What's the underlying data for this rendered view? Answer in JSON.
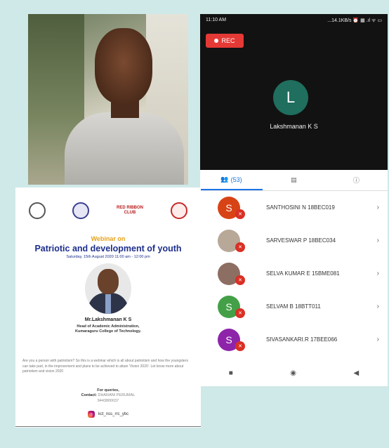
{
  "phone": {
    "time": "11:10 AM",
    "network": "...14.1KB/s ⏰ ▦ .ıl ᯤ ▭",
    "rec_label": "REC",
    "host_initial": "L",
    "host_name": "Lakshmanan K S",
    "tabs": [
      {
        "label": "(53)",
        "icon": "people-icon"
      },
      {
        "label": "",
        "icon": "chat-icon"
      },
      {
        "label": "",
        "icon": "info-icon"
      }
    ],
    "participants": [
      {
        "initial": "S",
        "name": "SANTHOSINI N 18BEC019",
        "color": "#d84315"
      },
      {
        "initial": "",
        "name": "SARVESWAR P 18BEC034",
        "color": "#9e8a7a"
      },
      {
        "initial": "",
        "name": "SELVA KUMAR E 15BME081",
        "color": "#8d6e63"
      },
      {
        "initial": "S",
        "name": "SELVAM B 18BTT011",
        "color": "#43a047"
      },
      {
        "initial": "S",
        "name": "SIVASANKARI.R 17BEE066",
        "color": "#8e24aa"
      }
    ],
    "nav": [
      "■",
      "◉",
      "◀"
    ]
  },
  "poster": {
    "logo_text": "RED RIBBON CLUB",
    "webinar_on": "Webinar on",
    "title": "Patriotic and development of youth",
    "date": "Saturday, 15th August 2020  11:00 am - 12:00 pm",
    "speaker_name": "Mr.Lakshmanan K S",
    "speaker_role_1": "Head of Academic Administration,",
    "speaker_role_2": "Kumaraguru College of Technology.",
    "description": "Are you a person with patriotism? So this is a webinar which is all about patriotism and how the youngsters can take part, in the improvement and plans to be achieved to attain 'Vision 2020'. Let know more about patriotism and vision 2020",
    "queries_label": "For queries,",
    "contact_label": "Contact:",
    "contact_name": "DHARANI PERUMAL",
    "contact_phone": "9443800037",
    "instagram": "kct_nss_rrc_ybc"
  }
}
